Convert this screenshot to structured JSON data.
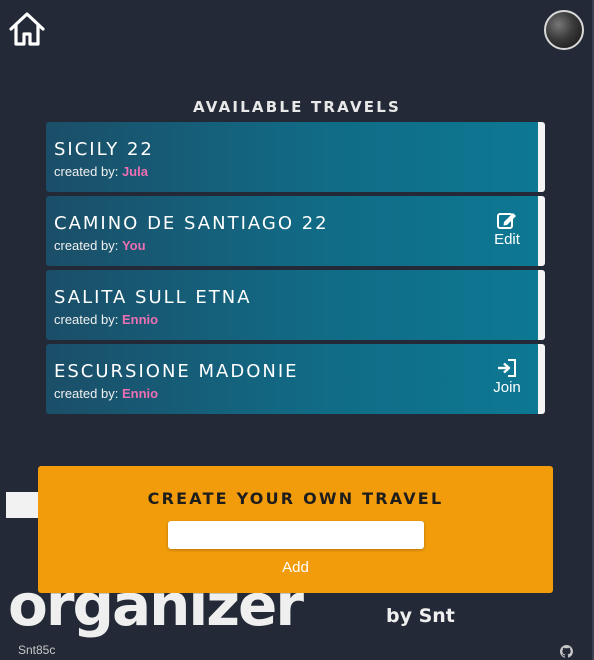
{
  "header": {
    "home_icon": "home-icon",
    "avatar_icon": "user-avatar"
  },
  "travels": {
    "title": "AVAILABLE TRAVELS",
    "items": [
      {
        "name": "SICILY 22",
        "created_by_label": "created by:",
        "creator": "Jula",
        "action": null
      },
      {
        "name": "CAMINO DE SANTIAGO 22",
        "created_by_label": "created by:",
        "creator": "You",
        "action": {
          "label": "Edit",
          "icon": "edit-icon"
        }
      },
      {
        "name": "SALITA SULL ETNA",
        "created_by_label": "created by:",
        "creator": "Ennio",
        "action": null
      },
      {
        "name": "ESCURSIONE MADONIE",
        "created_by_label": "created by:",
        "creator": "Ennio",
        "action": {
          "label": "Join",
          "icon": "sign-in-icon"
        }
      }
    ]
  },
  "create": {
    "title": "CREATE YOUR OWN TRAVEL",
    "input_value": "",
    "input_placeholder": "",
    "add_label": "Add"
  },
  "branding": {
    "app_name": "organizer",
    "by": "by Snt"
  },
  "footer": {
    "author": "Snt85c",
    "github_icon": "github-icon"
  },
  "colors": {
    "background": "#232936",
    "card_gradient_start": "#1b4e68",
    "card_gradient_end": "#0d7893",
    "creator_highlight": "#ec6fb3",
    "create_panel": "#f39c0b"
  }
}
